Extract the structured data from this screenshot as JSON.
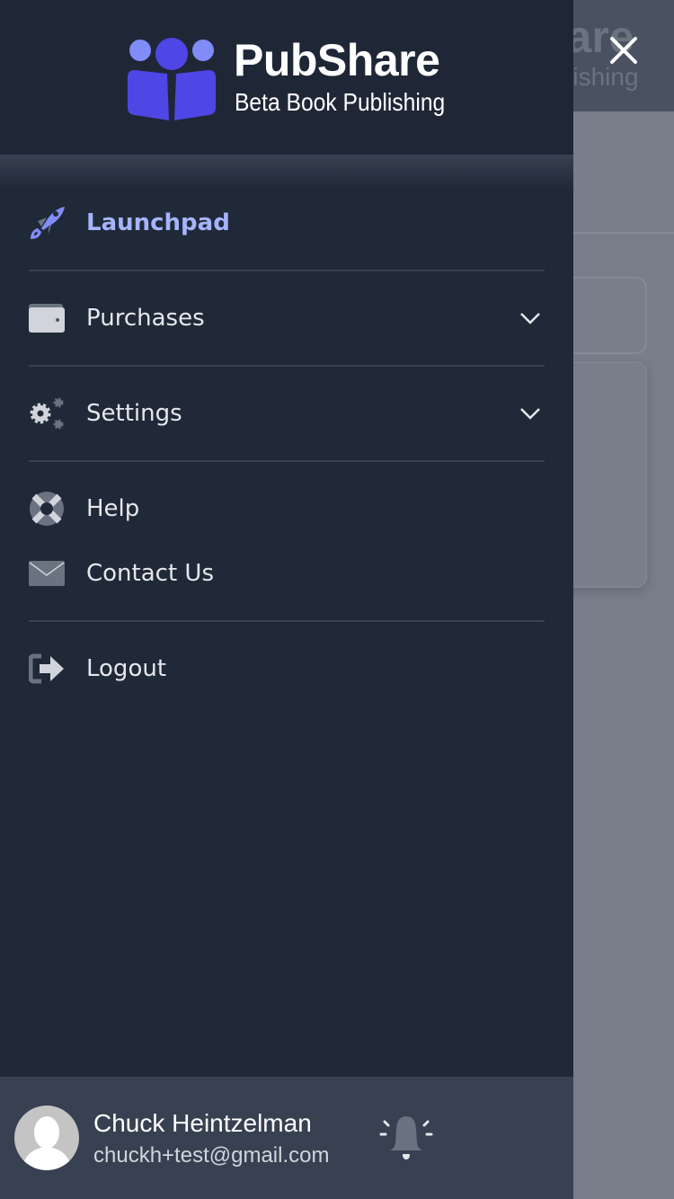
{
  "background": {
    "title_fragment": "hare",
    "subtitle_fragment": "ublishing"
  },
  "brand": {
    "name": "PubShare",
    "tagline": "Beta Book Publishing",
    "accent": "#4f46e5",
    "accent_light": "#818cf8"
  },
  "menu": {
    "items": [
      {
        "label": "Launchpad",
        "icon": "rocket-icon",
        "active": true
      },
      {
        "label": "Purchases",
        "icon": "wallet-icon",
        "expandable": true
      },
      {
        "label": "Settings",
        "icon": "gears-icon",
        "expandable": true
      },
      {
        "label": "Help",
        "icon": "life-ring-icon"
      },
      {
        "label": "Contact Us",
        "icon": "envelope-icon"
      },
      {
        "label": "Logout",
        "icon": "sign-out-icon"
      }
    ]
  },
  "user": {
    "name": "Chuck Heintzelman",
    "email": "chuckh+test@gmail.com"
  }
}
